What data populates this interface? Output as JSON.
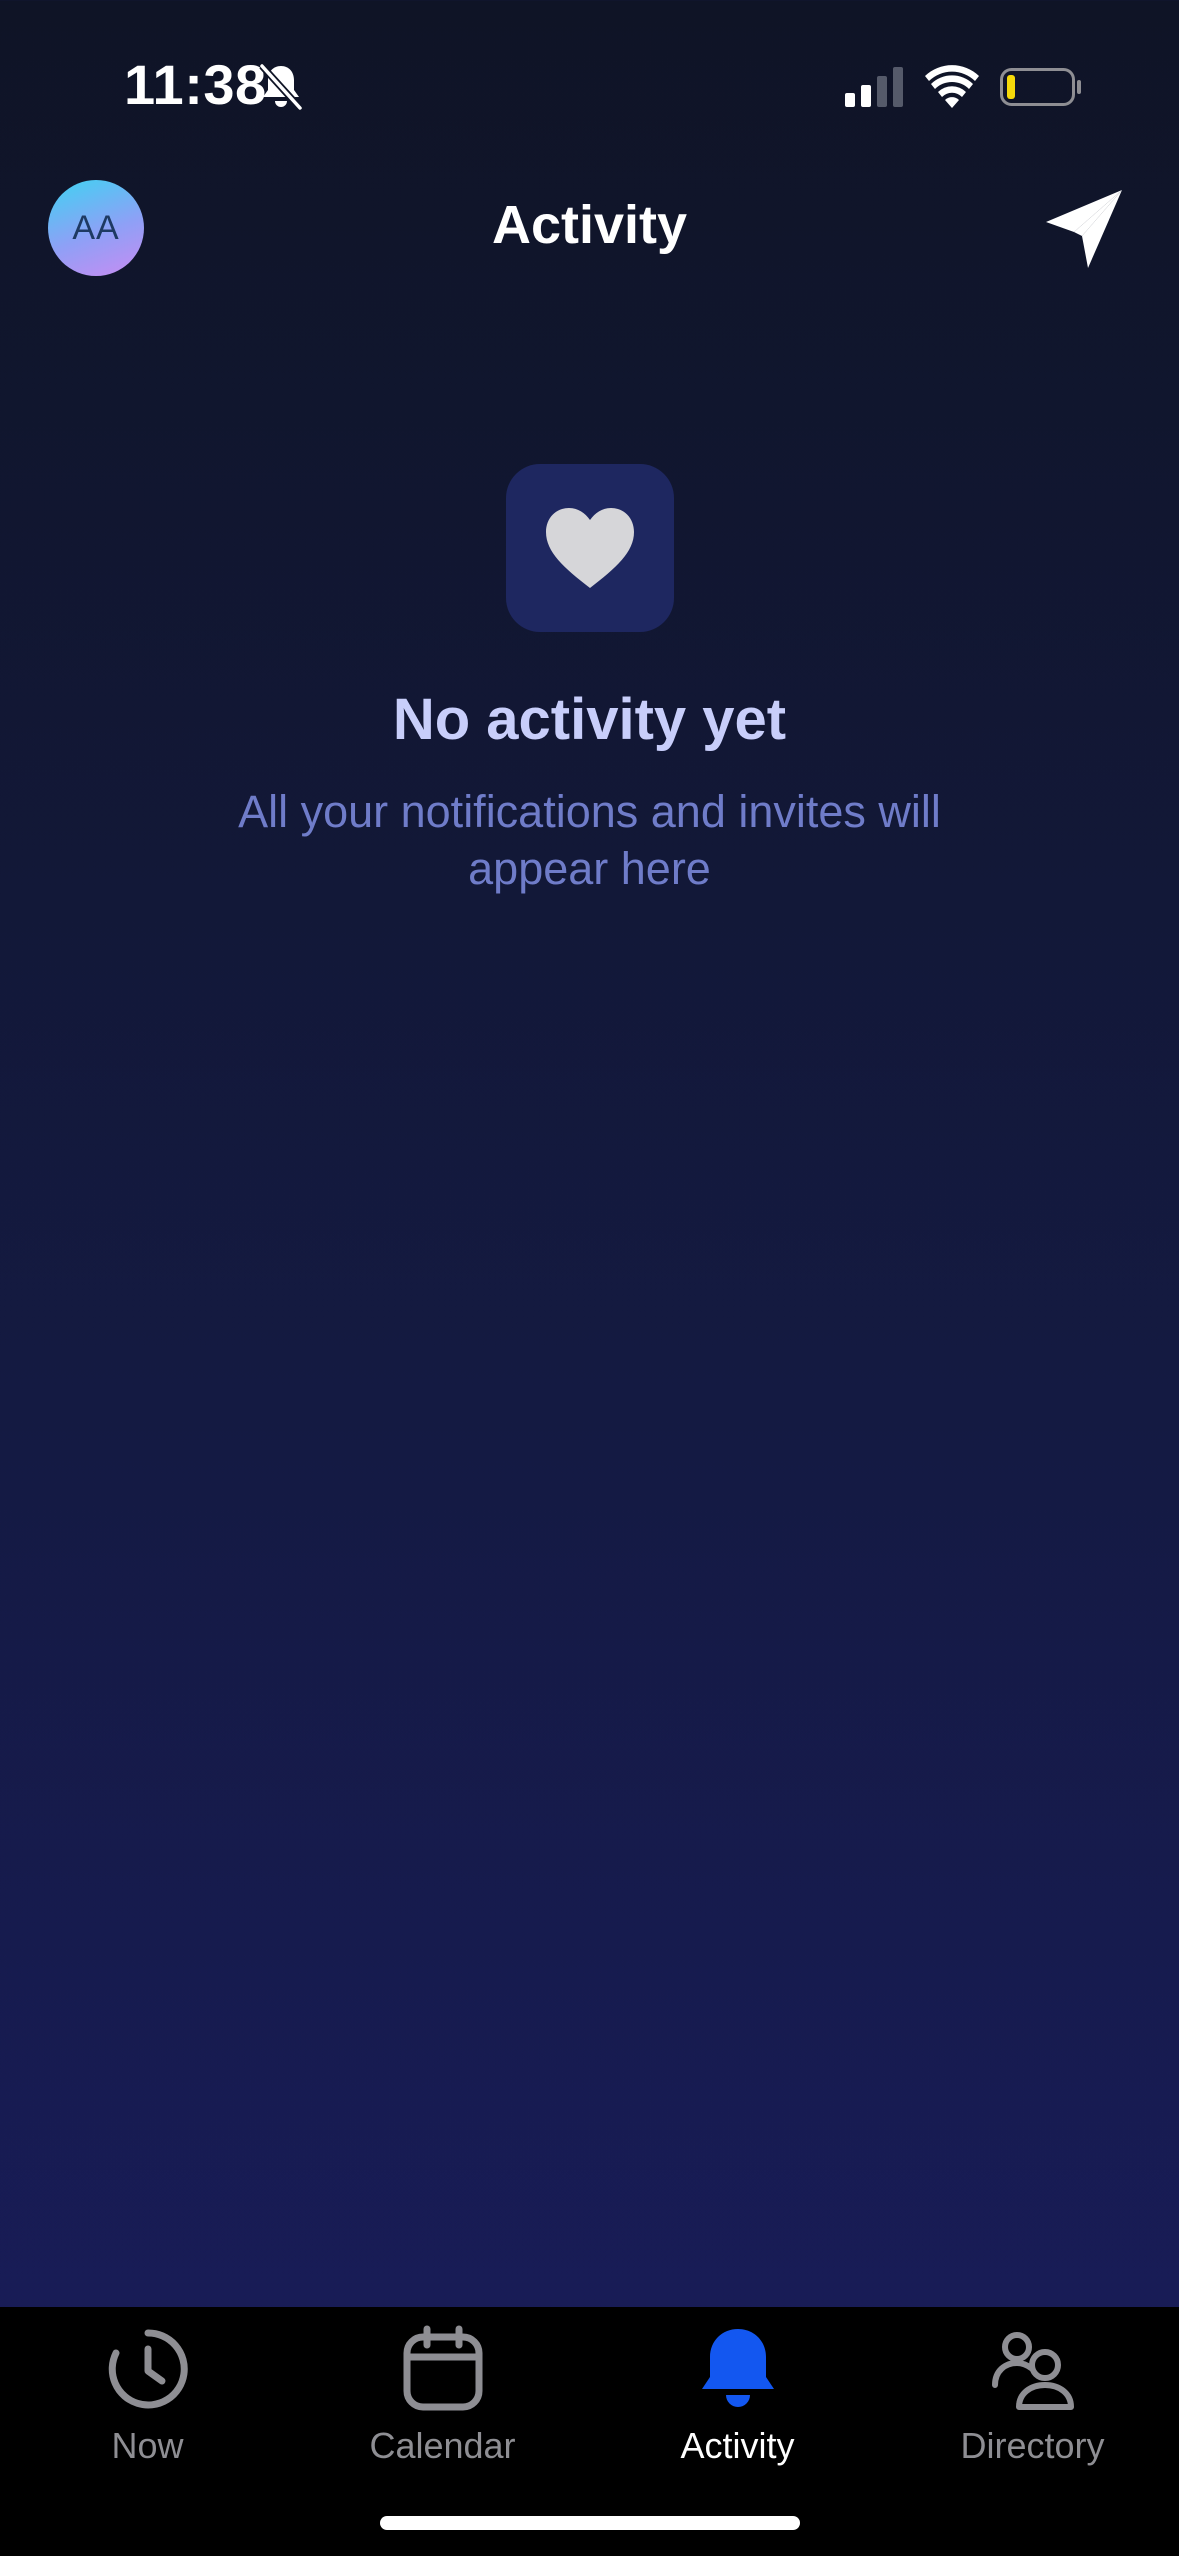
{
  "status_bar": {
    "time": "11:38",
    "silent_icon": "bell-slash-icon",
    "signal_icon": "cellular-signal-icon",
    "wifi_icon": "wifi-icon",
    "battery_icon": "battery-low-icon",
    "battery_color": "#f5d90a"
  },
  "header": {
    "avatar_initials": "AA",
    "title": "Activity",
    "send_icon": "paper-plane-icon"
  },
  "empty_state": {
    "icon": "heart-icon",
    "title": "No activity yet",
    "subtitle": "All your notifications and invites will appear here"
  },
  "tab_bar": {
    "active_color": "#1357f0",
    "inactive_color": "#8e8e93",
    "tabs": [
      {
        "label": "Now",
        "icon": "clock-icon",
        "active": false
      },
      {
        "label": "Calendar",
        "icon": "calendar-icon",
        "active": false
      },
      {
        "label": "Activity",
        "icon": "bell-icon",
        "active": true
      },
      {
        "label": "Directory",
        "icon": "people-icon",
        "active": false
      }
    ]
  }
}
